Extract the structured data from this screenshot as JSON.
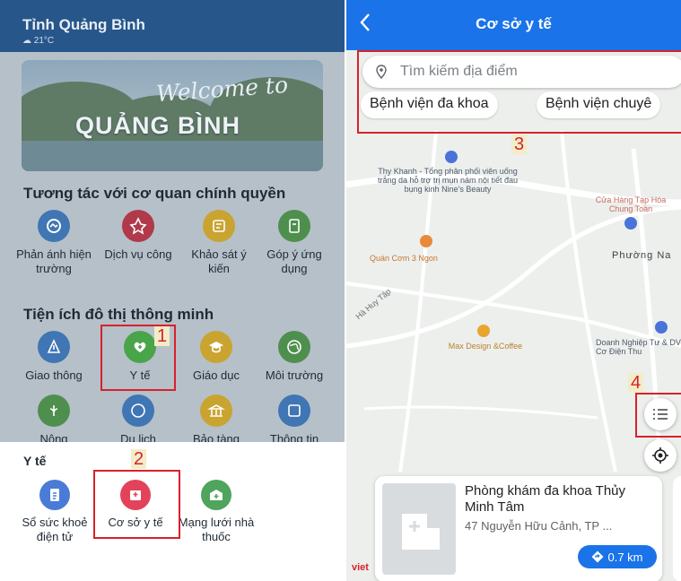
{
  "left": {
    "province": "Tỉnh Quảng Bình",
    "weather": "21°C",
    "banner": {
      "welcome": "Welcome to",
      "place": "QUẢNG BÌNH"
    },
    "section1": {
      "title": "Tương tác với cơ quan chính quyền",
      "items": [
        {
          "label": "Phản ánh hiện trường",
          "icon": "report-icon"
        },
        {
          "label": "Dịch vụ công",
          "icon": "public-service-icon"
        },
        {
          "label": "Khảo sát ý kiến",
          "icon": "survey-icon"
        },
        {
          "label": "Góp ý ứng dụng",
          "icon": "feedback-icon"
        }
      ]
    },
    "section2": {
      "title": "Tiện ích đô thị thông minh",
      "items": [
        {
          "label": "Giao thông",
          "icon": "traffic-icon"
        },
        {
          "label": "Y tế",
          "icon": "health-heart-icon"
        },
        {
          "label": "Giáo dục",
          "icon": "graduation-icon"
        },
        {
          "label": "Môi trường",
          "icon": "globe-icon"
        }
      ],
      "row2": [
        {
          "label": "Nông",
          "icon": "agriculture-icon"
        },
        {
          "label": "Du lịch",
          "icon": "travel-icon"
        },
        {
          "label": "Bảo tàng",
          "icon": "museum-icon"
        },
        {
          "label": "Thông tin",
          "icon": "map-info-icon"
        }
      ]
    },
    "sheet": {
      "title": "Y tế",
      "items": [
        {
          "label": "Sổ sức khoẻ điện tử",
          "icon": "health-record-icon"
        },
        {
          "label": "Cơ sở y tế",
          "icon": "hospital-icon"
        },
        {
          "label": "Mạng lưới nhà thuốc",
          "icon": "pharmacy-icon"
        }
      ]
    },
    "tags": {
      "t1": "1",
      "t2": "2"
    }
  },
  "right": {
    "header_title": "Cơ sở y tế",
    "search_placeholder": "Tìm kiếm địa điểm",
    "chips": [
      "Bệnh viện đa khoa",
      "Bệnh viện chuyê"
    ],
    "pois": [
      {
        "name": "Thy Khanh - Tổng phân phối viên uống trắng da hỗ trợ trị mụn nám nội tiết đau bụng kinh Nine's Beauty"
      },
      {
        "name": "Cửa Hàng Tạp Hóa Chung Toàn"
      },
      {
        "name": "Quán Cơm 3 Ngon"
      },
      {
        "name": "Phường Na"
      },
      {
        "name": "Max Design &Coffee"
      },
      {
        "name": "Doanh Nghiệp Tư & DV Cơ Điện Thu"
      }
    ],
    "street": "Hà Huy Tập",
    "card": {
      "name": "Phòng khám đa khoa Thủy Minh Tâm",
      "address": "47 Nguyễn Hữu Cảnh, TP ...",
      "distance": "0.7 km"
    },
    "brand": "viet",
    "tags": {
      "t3": "3",
      "t4": "4"
    }
  },
  "colors": {
    "header_left": "#27568a",
    "header_right": "#1a73e8",
    "highlight": "#d6222b"
  }
}
